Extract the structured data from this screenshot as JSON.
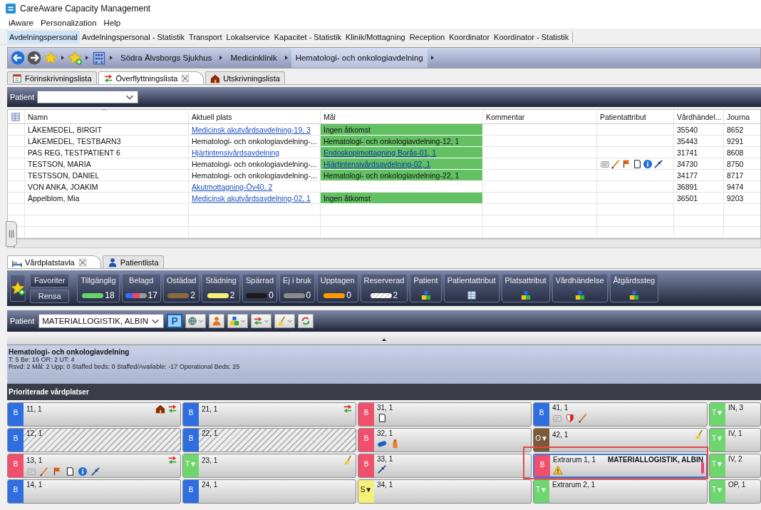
{
  "window": {
    "title": "CareAware Capacity Management"
  },
  "menu": [
    "iAware",
    "Personalization",
    "Help"
  ],
  "perspectives": [
    {
      "label": "Avdelningspersonal",
      "selected": true
    },
    {
      "label": "Avdelningspersonal - Statistik",
      "selected": false
    },
    {
      "label": "Transport",
      "selected": false
    },
    {
      "label": "Lokalservice",
      "selected": false
    },
    {
      "label": "Kapacitet - Statistik",
      "selected": false
    },
    {
      "label": "Klinik/Mottagning",
      "selected": false
    },
    {
      "label": "Reception",
      "selected": false
    },
    {
      "label": "Koordinator",
      "selected": false
    },
    {
      "label": "Koordinator - Statistik",
      "selected": false
    }
  ],
  "breadcrumb": [
    {
      "label": "Södra Älvsborgs Sjukhus",
      "selected": false
    },
    {
      "label": "Medicinklinik",
      "selected": false
    },
    {
      "label": "Hematologi- och onkologiavdelning",
      "selected": true
    }
  ],
  "top_tabs": [
    {
      "label": "Förinskrivningslista",
      "selected": false,
      "closable": false
    },
    {
      "label": "Överflyttningslista",
      "selected": true,
      "closable": true
    },
    {
      "label": "Utskrivningslista",
      "selected": false,
      "closable": false
    }
  ],
  "patient_filter": {
    "label": "Patient"
  },
  "table": {
    "columns": [
      "Namn",
      "Aktuell plats",
      "Mål",
      "Kommentar",
      "Patientattribut",
      "Vårdhändel...",
      "Journa"
    ],
    "rows": [
      {
        "name": "LÄKEMEDEL, BIRGIT",
        "location": {
          "text": "Medicinsk akutvårdsavdelning-19, 3",
          "link": true
        },
        "goal": {
          "text": "Ingen åtkomst",
          "link": false
        },
        "event": "35540",
        "journal": "8652"
      },
      {
        "name": "LÄKEMEDEL, TESTBARN3",
        "location": {
          "text": "Hematologi- och onkologiavdelning-...",
          "link": false
        },
        "goal": {
          "text": "Hematologi- och onkologiavdelning-12, 1",
          "link": false
        },
        "event": "35443",
        "journal": "9291"
      },
      {
        "name": "PAS REG, TESTPATIENT 6",
        "location": {
          "text": "Hjärtintensivårdsavdelning",
          "link": true
        },
        "goal": {
          "text": "Endoskopimottagning Borås-01, 1",
          "link": true
        },
        "event": "31741",
        "journal": "8608"
      },
      {
        "name": "TESTSON, MARIA",
        "location": {
          "text": "Hematologi- och onkologiavdelning-...",
          "link": false
        },
        "goal": {
          "text": "Hjärtintensivårdsavdelning-02, 1",
          "link": true
        },
        "event": "34730",
        "journal": "8750"
      },
      {
        "name": "TESTSSON, DANIEL",
        "location": {
          "text": "Hematologi- och onkologiavdelning-...",
          "link": false
        },
        "goal": {
          "text": "Hematologi- och onkologiavdelning-22, 1",
          "link": false
        },
        "event": "34177",
        "journal": "8717"
      },
      {
        "name": "VON ANKA, JOAKIM",
        "location": {
          "text": "Akutmottagning-Öv40, 2",
          "link": true
        },
        "event": "36891",
        "journal": "9474"
      },
      {
        "name": "Äppelblom, Mia",
        "location": {
          "text": "Medicinsk akutvårdsavdelning-02, 1",
          "link": true
        },
        "goal": {
          "text": "Ingen åtkomst",
          "link": false
        },
        "event": "36501",
        "journal": "9203"
      }
    ]
  },
  "bottom_tabs": [
    {
      "label": "Vårdplatstavla",
      "selected": true,
      "closable": true
    },
    {
      "label": "Patientlista",
      "selected": false,
      "closable": false
    }
  ],
  "legend": {
    "favorites": "Favoriter",
    "clear": "Rensa",
    "filters": [
      {
        "label": "Tillgänglig",
        "kind": "status",
        "color": "#66d466",
        "count": "18"
      },
      {
        "label": "Belagd",
        "kind": "mixed",
        "color": "#ee4466",
        "count": "17"
      },
      {
        "label": "Ostädad",
        "kind": "status",
        "color": "#8a6a40",
        "count": "2"
      },
      {
        "label": "Städning",
        "kind": "status",
        "color": "#f5f07a",
        "count": "2"
      },
      {
        "label": "Spärrad",
        "kind": "status",
        "color": "#1a1a1a",
        "count": "0"
      },
      {
        "label": "Ej i bruk",
        "kind": "status",
        "color": "#8a8a8a",
        "count": "0"
      },
      {
        "label": "Upptagen",
        "kind": "status",
        "color": "#ff9900",
        "count": "0"
      },
      {
        "label": "Reserverad",
        "kind": "hatched",
        "color": "#dddddd",
        "count": "2"
      },
      {
        "label": "Patient",
        "kind": "attribute"
      },
      {
        "label": "Patientattribut",
        "kind": "attribute"
      },
      {
        "label": "Platsattribut",
        "kind": "attribute"
      },
      {
        "label": "Vårdhändelse",
        "kind": "attribute"
      },
      {
        "label": "Åtgärdssteg",
        "kind": "attribute"
      }
    ]
  },
  "patient_toolbar": {
    "label": "Patient",
    "value": "MATERIALLOGISTIK, ALBIN",
    "tools": [
      {
        "kind": "text",
        "label": "P"
      },
      {
        "kind": "icon",
        "menu": true
      },
      {
        "kind": "icon",
        "menu": false
      },
      {
        "kind": "icon",
        "menu": true
      },
      {
        "kind": "icon",
        "menu": true
      },
      {
        "kind": "icon",
        "menu": true
      },
      {
        "kind": "icon",
        "menu": false
      }
    ]
  },
  "ward": {
    "title": "Hematologi- och onkologiavdelning",
    "lines": [
      "T: 5 Be: 16 OR: 2 UT: 4",
      "Rsvd: 2 Mål: 2 Upp: 0 Staffed beds: 0 Staffed/Available: -17 Operational Beds: 25"
    ]
  },
  "beds": {
    "header": "Prioriterade vårdplatser",
    "rows": [
      [
        {
          "label": "11, 1",
          "status": "B",
          "color": "#2f6ee0"
        },
        {
          "label": "21, 1",
          "status": "B",
          "color": "#2f6ee0"
        },
        {
          "label": "31, 1",
          "status": "B",
          "color": "#f0506e"
        },
        {
          "label": "41, 1",
          "status": "B",
          "color": "#2f6ee0"
        },
        {
          "label": "IN, 3",
          "status": "T▼",
          "color": "#6fd66f"
        }
      ],
      [
        {
          "label": "12, 1",
          "status": "B",
          "color": "#2f6ee0",
          "hatched": true
        },
        {
          "label": "22, 1",
          "status": "B",
          "color": "#2f6ee0",
          "hatched": true
        },
        {
          "label": "32, 1",
          "status": "B",
          "color": "#f0506e"
        },
        {
          "label": "42, 1",
          "status": "O▼",
          "color": "#7a5a38"
        },
        {
          "label": "IV, 1",
          "status": "T▼",
          "color": "#6fd66f"
        }
      ],
      [
        {
          "label": "13, 1",
          "status": "B",
          "color": "#f0506e"
        },
        {
          "label": "23, 1",
          "status": "T▼",
          "color": "#6fd66f"
        },
        {
          "label": "33, 1",
          "status": "B",
          "color": "#f0506e"
        },
        {
          "label": "Extrarum 1, 1",
          "status": "B",
          "color": "#f0506e",
          "patient": "MATERIALLOGISTIK, ALBIN",
          "selected": true,
          "highlighted": true
        },
        {
          "label": "IV, 2",
          "status": "T▼",
          "color": "#6fd66f"
        }
      ],
      [
        {
          "label": "14, 1",
          "status": "B",
          "color": "#2f6ee0"
        },
        {
          "label": "24, 1",
          "status": "B",
          "color": "#2f6ee0"
        },
        {
          "label": "34, 1",
          "status": "S▼",
          "color": "#f5f07a"
        },
        {
          "label": "Extrarum 2, 1",
          "status": "T▼",
          "color": "#6fd66f"
        },
        {
          "label": "OP, 1",
          "status": "T▼",
          "color": "#6fd66f"
        }
      ]
    ]
  }
}
